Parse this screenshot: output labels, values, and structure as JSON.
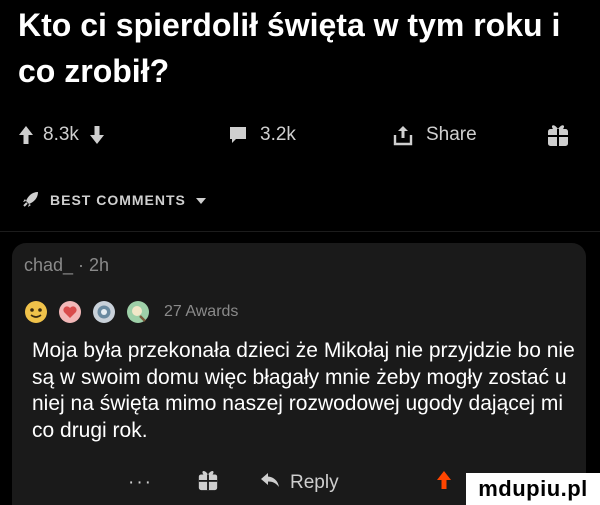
{
  "post": {
    "title": "Kto ci spierdolił święta w tym roku i co zrobił?"
  },
  "actions": {
    "upvotes": "8.3k",
    "comments": "3.2k",
    "share_label": "Share"
  },
  "comments_section": {
    "sort_label": "BEST COMMENTS"
  },
  "comment": {
    "meta": "chad_ · 2h",
    "awards_label": "27 Awards",
    "body": "Moja była przekonała dzieci że Mikołaj nie przyjdzie bo nie są w swoim domu więc błagały mnie żeby mogły zostać u niej na święta mimo naszej rozwodowej ugody dającej mi co drugi rok.",
    "more_label": "···",
    "reply_label": "Reply"
  },
  "watermark": {
    "text": "mdupiu.pl"
  },
  "colors": {
    "background": "#000000",
    "card": "#1a1a1a",
    "text": "#ffffff",
    "muted": "#8a8a8a",
    "icon": "#cfcfcf"
  }
}
